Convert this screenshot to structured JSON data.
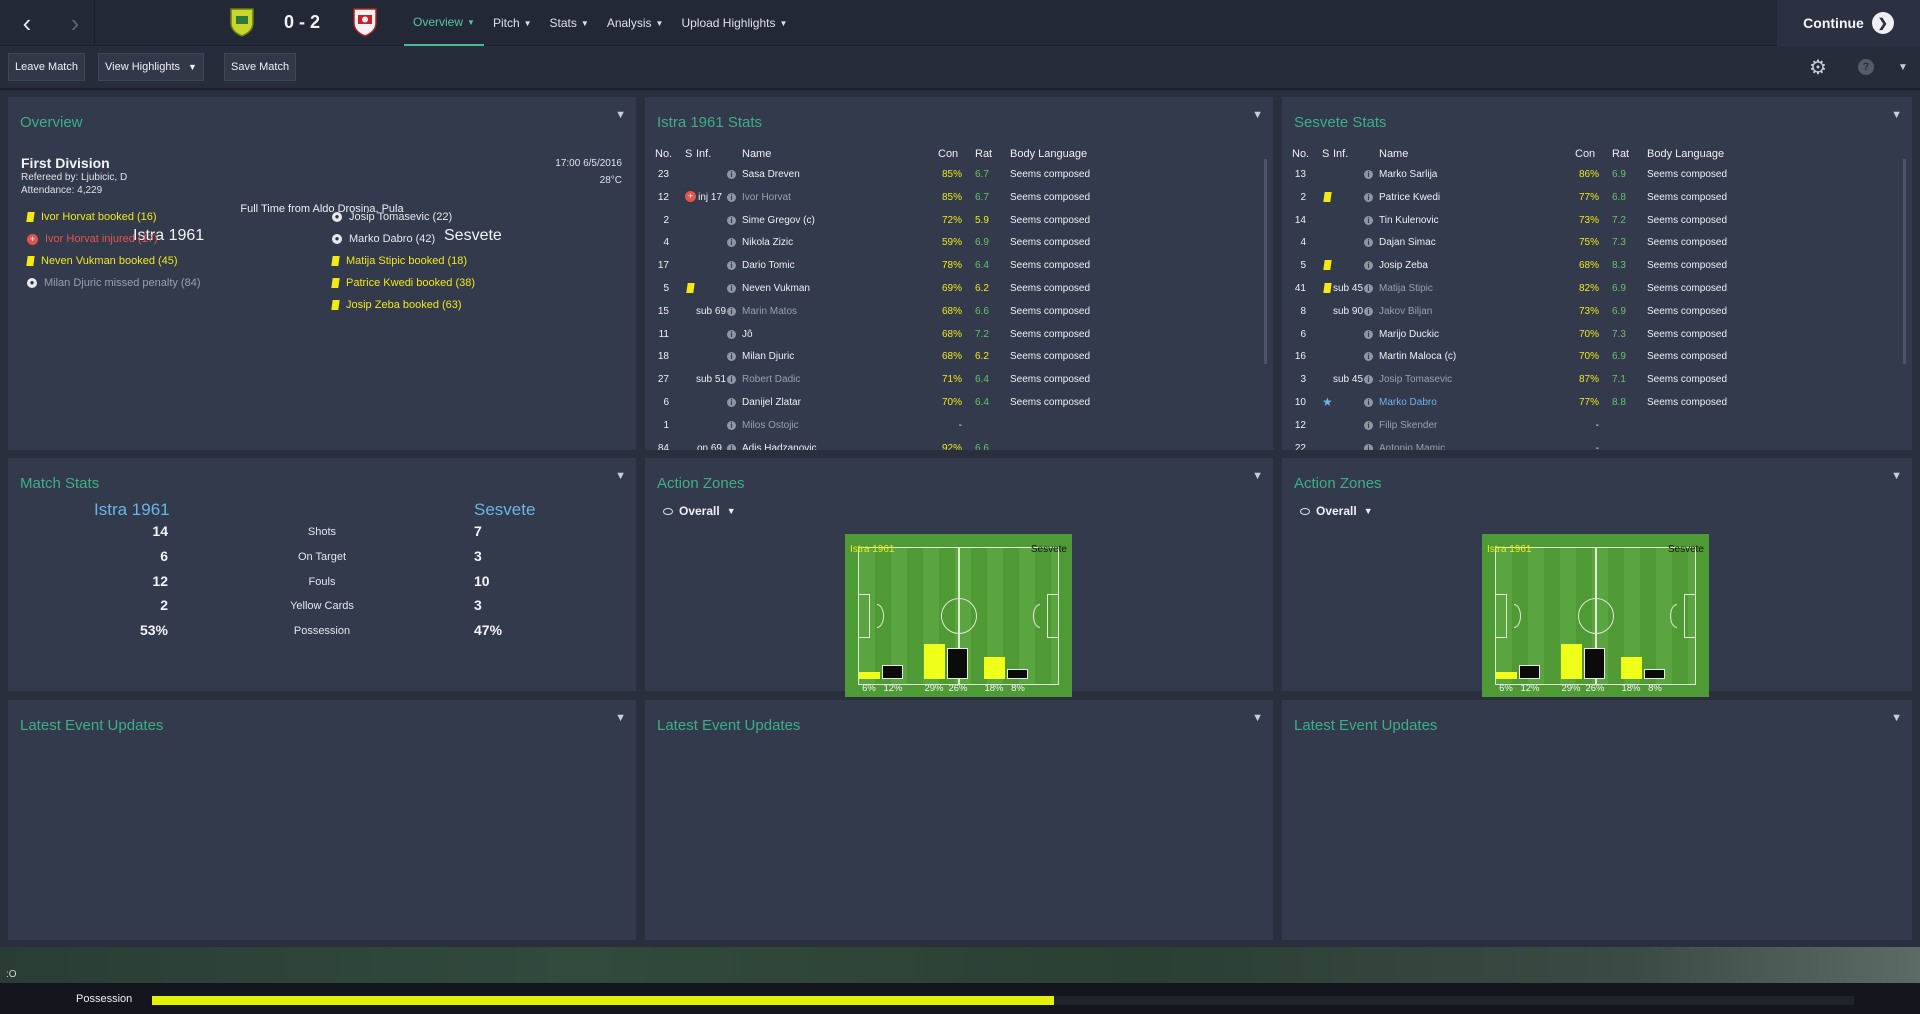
{
  "topbar": {
    "back_icon": "chevron-left-icon",
    "forward_icon": "chevron-right-icon",
    "score": "0 - 2",
    "home_crest": "istra-crest-icon",
    "away_crest": "sesvete-crest-icon",
    "menu": [
      "Overview",
      "Pitch",
      "Stats",
      "Analysis",
      "Upload Highlights"
    ],
    "active_menu": "Overview",
    "continue_label": "Continue",
    "continue_icon": "arrow-right-circle-icon"
  },
  "toolbar": {
    "leave": "Leave Match",
    "highlights": "View Highlights",
    "save": "Save Match",
    "settings_icon": "gear-icon",
    "help_icon": "help-icon",
    "more_icon": "chevron-down-icon"
  },
  "overview": {
    "title": "Overview",
    "competition": "First Division",
    "referee": "Refereed by: Ljubicic, D",
    "attendance": "Attendance: 4,229",
    "datetime": "17:00 6/5/2016",
    "temperature": "28°C",
    "fulltime": "Full Time from Aldo Drosina, Pula",
    "home_team": "Istra 1961",
    "away_team": "Sesvete",
    "home_events": [
      {
        "text": "Ivor Horvat booked (16)",
        "type": "yellow"
      },
      {
        "text": "Ivor Horvat injured (17)",
        "type": "injury"
      },
      {
        "text": "Neven Vukman booked (45)",
        "type": "yellow"
      },
      {
        "text": "Milan Djuric missed penalty (84)",
        "type": "missed"
      }
    ],
    "away_events": [
      {
        "text": "Josip Tomasevic (22)",
        "type": "goal"
      },
      {
        "text": "Marko Dabro (42)",
        "type": "goal"
      },
      {
        "text": "Matija Stipic booked (18)",
        "type": "yellow"
      },
      {
        "text": "Patrice Kwedi booked (38)",
        "type": "yellow"
      },
      {
        "text": "Josip Zeba booked (63)",
        "type": "yellow"
      }
    ]
  },
  "istra_stats": {
    "title": "Istra 1961 Stats",
    "headers": {
      "no": "No.",
      "s": "S",
      "inf": "Inf.",
      "name": "Name",
      "con": "Con",
      "rat": "Rat",
      "body": "Body Language"
    },
    "rows": [
      {
        "no": "23",
        "s": "",
        "inf": "",
        "name": "Sasa Dreven",
        "con": "85%",
        "rat": "6.7",
        "body": "Seems composed",
        "dim": false
      },
      {
        "no": "12",
        "s": "injury",
        "inf": "inj 17",
        "name": "Ivor Horvat",
        "con": "85%",
        "rat": "6.7",
        "body": "Seems composed",
        "dim": true
      },
      {
        "no": "2",
        "s": "",
        "inf": "",
        "name": "Sime Gregov (c)",
        "con": "72%",
        "rat": "5.9",
        "body": "Seems composed",
        "dim": false
      },
      {
        "no": "4",
        "s": "",
        "inf": "",
        "name": "Nikola Zizic",
        "con": "59%",
        "rat": "6.9",
        "body": "Seems composed",
        "dim": false
      },
      {
        "no": "17",
        "s": "",
        "inf": "",
        "name": "Dario Tomic",
        "con": "78%",
        "rat": "6.4",
        "body": "Seems composed",
        "dim": false
      },
      {
        "no": "5",
        "s": "yellow",
        "inf": "",
        "name": "Neven Vukman",
        "con": "69%",
        "rat": "6.2",
        "body": "Seems composed",
        "dim": false
      },
      {
        "no": "15",
        "s": "",
        "inf": "sub 69",
        "name": "Marin Matos",
        "con": "68%",
        "rat": "6.6",
        "body": "Seems composed",
        "dim": true
      },
      {
        "no": "11",
        "s": "",
        "inf": "",
        "name": "Jô",
        "con": "68%",
        "rat": "7.2",
        "body": "Seems composed",
        "dim": false
      },
      {
        "no": "18",
        "s": "",
        "inf": "",
        "name": "Milan Djuric",
        "con": "68%",
        "rat": "6.2",
        "body": "Seems composed",
        "dim": false
      },
      {
        "no": "27",
        "s": "",
        "inf": "sub 51",
        "name": "Robert Dadic",
        "con": "71%",
        "rat": "6.4",
        "body": "Seems composed",
        "dim": true
      },
      {
        "no": "6",
        "s": "",
        "inf": "",
        "name": "Danijel Zlatar",
        "con": "70%",
        "rat": "6.4",
        "body": "Seems composed",
        "dim": false
      },
      {
        "no": "1",
        "s": "",
        "inf": "",
        "name": "Milos Ostojic",
        "con": "-",
        "rat": "",
        "body": "",
        "dim": true
      },
      {
        "no": "84",
        "s": "",
        "inf": "on 69",
        "name": "Adis Hadzanovic",
        "con": "92%",
        "rat": "6.6",
        "body": "",
        "dim": false
      }
    ]
  },
  "sesvete_stats": {
    "title": "Sesvete Stats",
    "headers": {
      "no": "No.",
      "s": "S",
      "inf": "Inf.",
      "name": "Name",
      "con": "Con",
      "rat": "Rat",
      "body": "Body Language"
    },
    "rows": [
      {
        "no": "13",
        "s": "",
        "inf": "",
        "name": "Marko Sarlija",
        "con": "86%",
        "rat": "6.9",
        "body": "Seems composed",
        "dim": false
      },
      {
        "no": "2",
        "s": "yellow",
        "inf": "",
        "name": "Patrice Kwedi",
        "con": "77%",
        "rat": "6.8",
        "body": "Seems composed",
        "dim": false
      },
      {
        "no": "14",
        "s": "",
        "inf": "",
        "name": "Tin Kulenovic",
        "con": "73%",
        "rat": "7.2",
        "body": "Seems composed",
        "dim": false
      },
      {
        "no": "4",
        "s": "",
        "inf": "",
        "name": "Dajan Simac",
        "con": "75%",
        "rat": "7.3",
        "body": "Seems composed",
        "dim": false
      },
      {
        "no": "5",
        "s": "yellow",
        "inf": "",
        "name": "Josip Zeba",
        "con": "68%",
        "rat": "8.3",
        "body": "Seems composed",
        "dim": false
      },
      {
        "no": "41",
        "s": "yellow",
        "inf": "sub 45",
        "name": "Matija Stipic",
        "con": "82%",
        "rat": "6.9",
        "body": "Seems composed",
        "dim": true
      },
      {
        "no": "8",
        "s": "",
        "inf": "sub 90",
        "name": "Jakov Biljan",
        "con": "73%",
        "rat": "6.9",
        "body": "Seems composed",
        "dim": true
      },
      {
        "no": "6",
        "s": "",
        "inf": "",
        "name": "Marijo Duckic",
        "con": "70%",
        "rat": "7.3",
        "body": "Seems composed",
        "dim": false
      },
      {
        "no": "16",
        "s": "",
        "inf": "",
        "name": "Martin Maloca (c)",
        "con": "70%",
        "rat": "6.9",
        "body": "Seems composed",
        "dim": false
      },
      {
        "no": "3",
        "s": "",
        "inf": "sub 45",
        "name": "Josip Tomasevic",
        "con": "87%",
        "rat": "7.1",
        "body": "Seems composed",
        "dim": true
      },
      {
        "no": "10",
        "s": "star",
        "inf": "",
        "name": "Marko Dabro",
        "con": "77%",
        "rat": "8.8",
        "body": "Seems composed",
        "dim": false,
        "highlight": true
      },
      {
        "no": "12",
        "s": "",
        "inf": "",
        "name": "Filip Skender",
        "con": "-",
        "rat": "",
        "body": "",
        "dim": true
      },
      {
        "no": "22",
        "s": "",
        "inf": "",
        "name": "Antonio Mamic",
        "con": "-",
        "rat": "",
        "body": "",
        "dim": true
      }
    ]
  },
  "match_stats": {
    "title": "Match Stats",
    "home": "Istra 1961",
    "away": "Sesvete",
    "rows": [
      {
        "label": "Shots",
        "home": "14",
        "away": "7"
      },
      {
        "label": "On Target",
        "home": "6",
        "away": "3"
      },
      {
        "label": "Fouls",
        "home": "12",
        "away": "10"
      },
      {
        "label": "Yellow Cards",
        "home": "2",
        "away": "3"
      },
      {
        "label": "Possession",
        "home": "53%",
        "away": "47%"
      }
    ]
  },
  "action_zones": [
    {
      "title": "Action Zones",
      "selector": "Overall",
      "home": "Istra 1961",
      "away": "Sesvete",
      "zones": [
        {
          "home": "6%",
          "away": "12%",
          "home_v": 6,
          "away_v": 12
        },
        {
          "home": "29%",
          "away": "26%",
          "home_v": 29,
          "away_v": 26
        },
        {
          "home": "18%",
          "away": "8%",
          "home_v": 18,
          "away_v": 8
        }
      ]
    },
    {
      "title": "Action Zones",
      "selector": "Overall",
      "home": "Istra 1961",
      "away": "Sesvete",
      "zones": [
        {
          "home": "6%",
          "away": "12%",
          "home_v": 6,
          "away_v": 12
        },
        {
          "home": "29%",
          "away": "26%",
          "home_v": 29,
          "away_v": 26
        },
        {
          "home": "18%",
          "away": "8%",
          "home_v": 18,
          "away_v": 8
        }
      ]
    }
  ],
  "latest": {
    "title": "Latest Event Updates"
  },
  "bottom": {
    "strip_text": ":O",
    "possession_label": "Possession",
    "possession_home": 0.53
  },
  "colors": {
    "accent": "#3fae86",
    "yellow": "#f0e91a",
    "panel": "#323a4b",
    "bg": "#2a2f3e"
  }
}
